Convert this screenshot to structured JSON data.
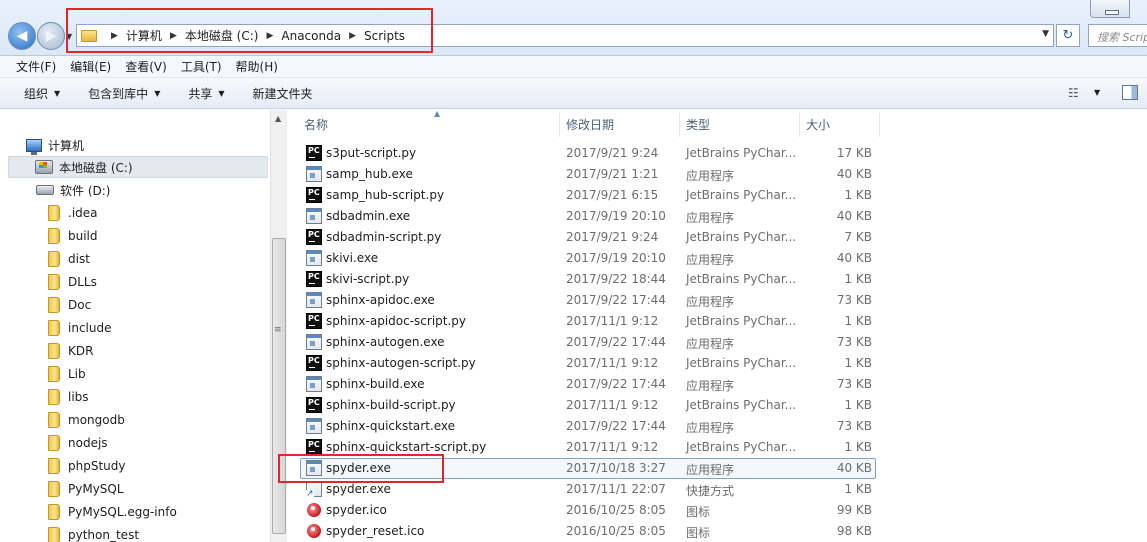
{
  "window": {
    "breadcrumb": [
      "计算机",
      "本地磁盘 (C:)",
      "Anaconda",
      "Scripts"
    ],
    "search_placeholder": "搜索 Scripts"
  },
  "menu": [
    "文件(F)",
    "编辑(E)",
    "查看(V)",
    "工具(T)",
    "帮助(H)"
  ],
  "toolbar": {
    "organize": "组织",
    "include_in_library": "包含到库中",
    "share": "共享",
    "new_folder": "新建文件夹"
  },
  "nav": {
    "computer": "计算机",
    "drive_c": "本地磁盘 (C:)",
    "drive_d": "软件 (D:)",
    "folders": [
      ".idea",
      "build",
      "dist",
      "DLLs",
      "Doc",
      "include",
      "KDR",
      "Lib",
      "libs",
      "mongodb",
      "nodejs",
      "phpStudy",
      "PyMySQL",
      "PyMySQL.egg-info",
      "python_test"
    ]
  },
  "columns": {
    "name": "名称",
    "date": "修改日期",
    "type": "类型",
    "size": "大小"
  },
  "files": [
    {
      "icon": "pycharm-file-icon",
      "name": "s3put-script.py",
      "date": "2017/9/21 9:24",
      "type": "JetBrains PyChar...",
      "size": "17 KB"
    },
    {
      "icon": "exe-icon",
      "name": "samp_hub.exe",
      "date": "2017/9/21 1:21",
      "type": "应用程序",
      "size": "40 KB"
    },
    {
      "icon": "pycharm-file-icon",
      "name": "samp_hub-script.py",
      "date": "2017/9/21 6:15",
      "type": "JetBrains PyChar...",
      "size": "1 KB"
    },
    {
      "icon": "exe-icon",
      "name": "sdbadmin.exe",
      "date": "2017/9/19 20:10",
      "type": "应用程序",
      "size": "40 KB"
    },
    {
      "icon": "pycharm-file-icon",
      "name": "sdbadmin-script.py",
      "date": "2017/9/21 9:24",
      "type": "JetBrains PyChar...",
      "size": "7 KB"
    },
    {
      "icon": "exe-icon",
      "name": "skivi.exe",
      "date": "2017/9/19 20:10",
      "type": "应用程序",
      "size": "40 KB"
    },
    {
      "icon": "pycharm-file-icon",
      "name": "skivi-script.py",
      "date": "2017/9/22 18:44",
      "type": "JetBrains PyChar...",
      "size": "1 KB"
    },
    {
      "icon": "exe-icon",
      "name": "sphinx-apidoc.exe",
      "date": "2017/9/22 17:44",
      "type": "应用程序",
      "size": "73 KB"
    },
    {
      "icon": "pycharm-file-icon",
      "name": "sphinx-apidoc-script.py",
      "date": "2017/11/1 9:12",
      "type": "JetBrains PyChar...",
      "size": "1 KB"
    },
    {
      "icon": "exe-icon",
      "name": "sphinx-autogen.exe",
      "date": "2017/9/22 17:44",
      "type": "应用程序",
      "size": "73 KB"
    },
    {
      "icon": "pycharm-file-icon",
      "name": "sphinx-autogen-script.py",
      "date": "2017/11/1 9:12",
      "type": "JetBrains PyChar...",
      "size": "1 KB"
    },
    {
      "icon": "exe-icon",
      "name": "sphinx-build.exe",
      "date": "2017/9/22 17:44",
      "type": "应用程序",
      "size": "73 KB"
    },
    {
      "icon": "pycharm-file-icon",
      "name": "sphinx-build-script.py",
      "date": "2017/11/1 9:12",
      "type": "JetBrains PyChar...",
      "size": "1 KB"
    },
    {
      "icon": "exe-icon",
      "name": "sphinx-quickstart.exe",
      "date": "2017/9/22 17:44",
      "type": "应用程序",
      "size": "73 KB"
    },
    {
      "icon": "pycharm-file-icon",
      "name": "sphinx-quickstart-script.py",
      "date": "2017/11/1 9:12",
      "type": "JetBrains PyChar...",
      "size": "1 KB"
    },
    {
      "icon": "exe-icon",
      "name": "spyder.exe",
      "date": "2017/10/18 3:27",
      "type": "应用程序",
      "size": "40 KB",
      "selected": true
    },
    {
      "icon": "shortcut-icon",
      "name": "spyder.exe",
      "date": "2017/11/1 22:07",
      "type": "快捷方式",
      "size": "1 KB"
    },
    {
      "icon": "ico-file-icon",
      "name": "spyder.ico",
      "date": "2016/10/25 8:05",
      "type": "图标",
      "size": "99 KB"
    },
    {
      "icon": "ico-file-icon",
      "name": "spyder_reset.ico",
      "date": "2016/10/25 8:05",
      "type": "图标",
      "size": "98 KB"
    }
  ]
}
